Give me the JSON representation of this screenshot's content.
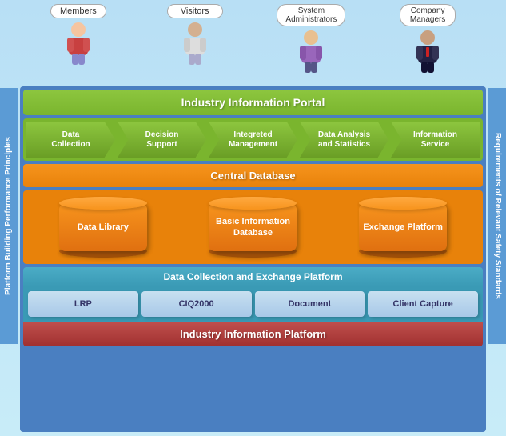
{
  "users": [
    {
      "id": "members",
      "label": "Members",
      "color": "#c05050",
      "shirt": "#d04444"
    },
    {
      "id": "visitors",
      "label": "Visitors",
      "color": "#6688aa",
      "shirt": "#ddd"
    },
    {
      "id": "system-administrators",
      "label": "System\nAdministrators",
      "color": "#8855aa",
      "shirt": "#9966bb"
    },
    {
      "id": "company-managers",
      "label": "Company\nManagers",
      "color": "#334466",
      "shirt": "#222244"
    }
  ],
  "side_labels": {
    "left": "Platform Building Performance Principles",
    "right": "Requirements of Relevant Safety Standards"
  },
  "portal_bar": "Industry Information Portal",
  "arrow_boxes": [
    {
      "id": "data-collection",
      "label": "Data\nCollection"
    },
    {
      "id": "decision-support",
      "label": "Decision\nSupport"
    },
    {
      "id": "integrated-management",
      "label": "Integreted\nManagement"
    },
    {
      "id": "data-analysis-statistics",
      "label": "Data Analysis\nand Statistics"
    },
    {
      "id": "information-service",
      "label": "Information\nService"
    }
  ],
  "central_db_bar": "Central Database",
  "cylinders": [
    {
      "id": "data-library",
      "label": "Data Library"
    },
    {
      "id": "basic-information-database",
      "label": "Basic Information\nDatabase"
    },
    {
      "id": "exchange-platform",
      "label": "Exchange Platform"
    }
  ],
  "exchange_platform_bar": "Data Collection and Exchange Platform",
  "bottom_boxes": [
    {
      "id": "lrp",
      "label": "LRP"
    },
    {
      "id": "ciq2000",
      "label": "CIQ2000"
    },
    {
      "id": "document",
      "label": "Document"
    },
    {
      "id": "client-capture",
      "label": "Client Capture"
    }
  ],
  "industry_platform_bar": "Industry Information Platform"
}
